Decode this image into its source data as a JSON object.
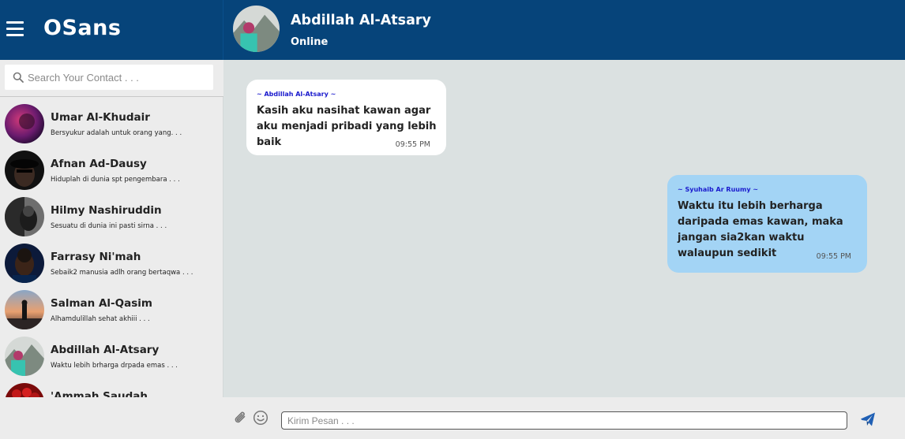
{
  "app": {
    "brand": "OSans"
  },
  "search": {
    "placeholder": "Search Your Contact . . ."
  },
  "contacts": [
    {
      "name": "Umar Al-Khudair",
      "preview": "Bersyukur adalah untuk orang yang. . ."
    },
    {
      "name": "Afnan Ad-Dausy",
      "preview": "Hiduplah di dunia spt pengembara . . ."
    },
    {
      "name": "Hilmy Nashiruddin",
      "preview": "Sesuatu di dunia ini pasti sirna . . ."
    },
    {
      "name": "Farrasy Ni'mah",
      "preview": "Sebaik2 manusia adlh orang bertaqwa . . ."
    },
    {
      "name": "Salman Al-Qasim",
      "preview": "Alhamdulillah sehat akhiii . . ."
    },
    {
      "name": "Abdillah Al-Atsary",
      "preview": "Waktu lebih brharga drpada emas . . ."
    },
    {
      "name": "'Ammah Saudah",
      "preview": ""
    }
  ],
  "header": {
    "name": "Abdillah Al-Atsary",
    "status": "Online"
  },
  "messages": [
    {
      "sender": "~ Abdillah Al-Atsary ~",
      "text": "Kasih aku nasihat kawan agar aku menjadi pribadi yang lebih baik",
      "time": "09:55 PM"
    },
    {
      "sender": "~ Syuhaib Ar Ruumy ~",
      "text": "Waktu itu lebih berharga daripada emas kawan, maka jangan sia2kan waktu walaupun sedikit",
      "time": "09:55 PM"
    }
  ],
  "composer": {
    "placeholder": "Kirim Pesan . . ."
  },
  "colors": {
    "header_bg": "#06447a",
    "chat_bg": "#dbe1e1",
    "sidebar_bg": "#ececec",
    "incoming_bubble": "#ffffff",
    "outgoing_bubble": "#a3d4f5",
    "sender_label": "#1a1acd",
    "send_icon": "#1f5fb4"
  },
  "icons": {
    "menu": "hamburger-menu-icon",
    "search": "search-icon",
    "attach": "paperclip-icon",
    "emoji": "smiley-icon",
    "send": "paper-plane-icon"
  }
}
